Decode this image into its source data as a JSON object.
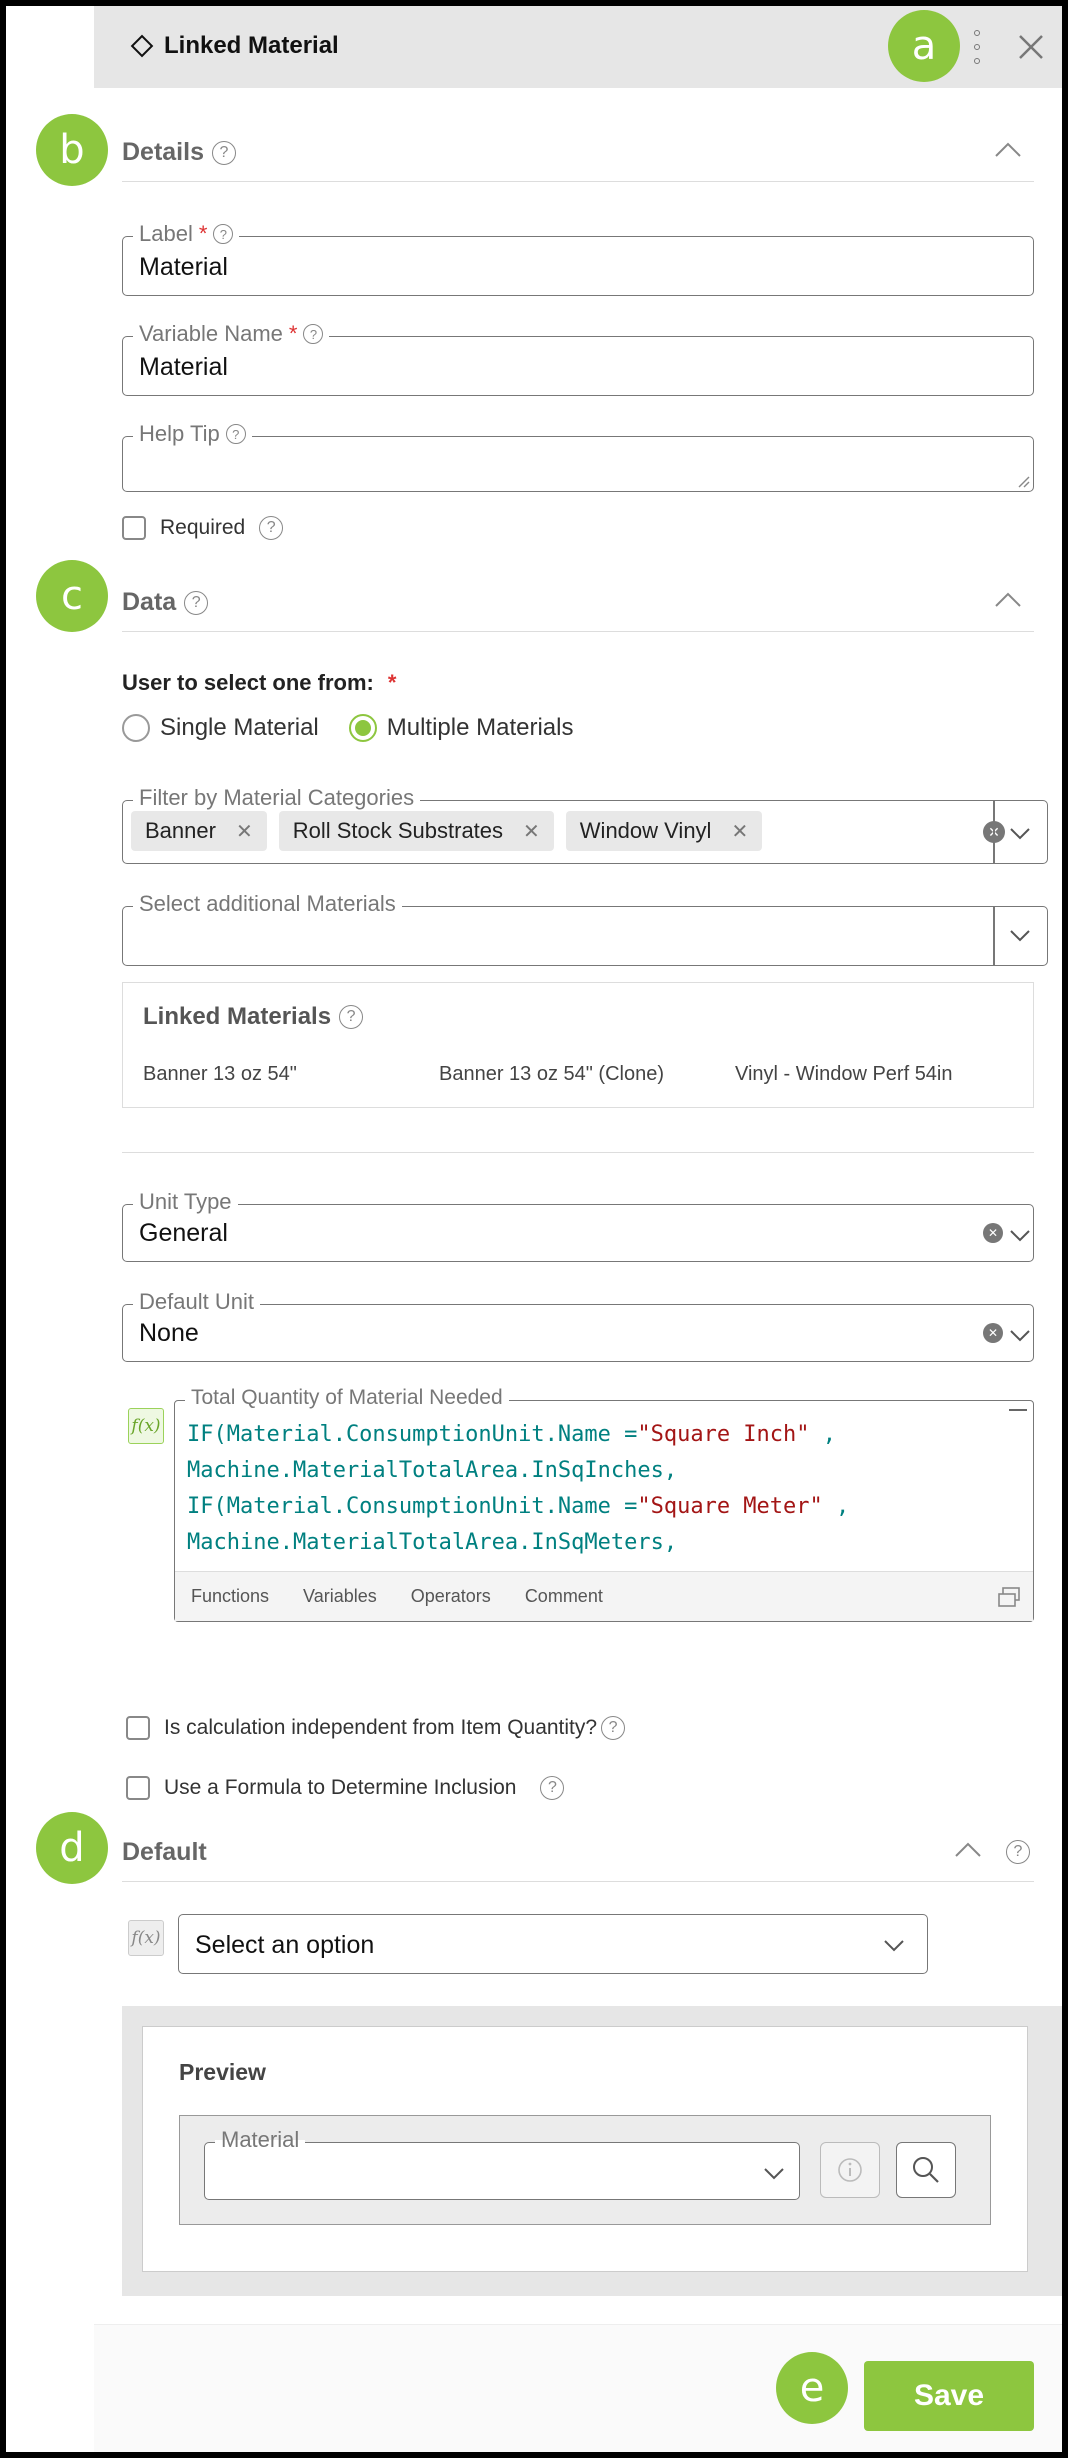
{
  "header": {
    "title": "Linked Material"
  },
  "badges": {
    "a": "a",
    "b": "b",
    "c": "c",
    "d": "d",
    "e": "e"
  },
  "details": {
    "title": "Details",
    "label_field": {
      "label": "Label",
      "value": "Material"
    },
    "variable_field": {
      "label": "Variable Name",
      "value": "Material"
    },
    "help_tip_field": {
      "label": "Help Tip",
      "value": ""
    },
    "required_label": "Required"
  },
  "data": {
    "title": "Data",
    "select_prompt": "User to select one from:",
    "radio_single": "Single Material",
    "radio_multiple": "Multiple Materials",
    "filter_label": "Filter by Material Categories",
    "chips": [
      "Banner",
      "Roll Stock Substrates",
      "Window Vinyl"
    ],
    "additional_label": "Select additional Materials",
    "linked_title": "Linked Materials",
    "linked_items": [
      "Banner 13 oz 54\"",
      "Banner 13 oz 54\" (Clone)",
      "Vinyl - Window Perf 54in"
    ],
    "unit_type": {
      "label": "Unit Type",
      "value": "General"
    },
    "default_unit": {
      "label": "Default Unit",
      "value": "None"
    },
    "formula_label": "Total Quantity of Material Needed",
    "code_toolbar": [
      "Functions",
      "Variables",
      "Operators",
      "Comment"
    ],
    "independent_label": "Is calculation independent from Item Quantity?",
    "inclusion_label": "Use a Formula to Determine Inclusion"
  },
  "default_section": {
    "title": "Default",
    "select_placeholder": "Select an option",
    "preview_title": "Preview",
    "preview_field_label": "Material"
  },
  "footer": {
    "save_label": "Save"
  },
  "colors": {
    "accent": "#8dc63f",
    "header_bg": "#e6e6e6",
    "required": "#dd3333"
  }
}
